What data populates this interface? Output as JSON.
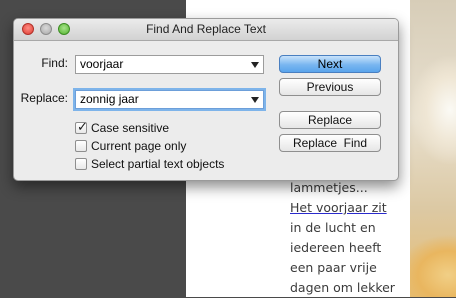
{
  "dialog": {
    "title": "Find And Replace Text",
    "find_label": "Find:",
    "find_value": "voorjaar",
    "replace_label": "Replace:",
    "replace_value": "zonnig jaar",
    "options": [
      {
        "label": "Case sensitive",
        "checked": true
      },
      {
        "label": "Current page only",
        "checked": false
      },
      {
        "label": "Select partial text objects",
        "checked": false
      }
    ],
    "buttons": {
      "next": "Next",
      "previous": "Previous",
      "replace": "Replace",
      "replace_find": "Replace  Find"
    }
  },
  "page_text": {
    "lines": [
      "lammetjes...",
      "Het voorjaar zit",
      "in de lucht en",
      "iedereen heeft",
      "een paar vrije",
      "dagen om lekker"
    ]
  },
  "colors": {
    "default_button": "#79b6f0",
    "focus_ring": "#7eb4ea",
    "text_underline": "#2a2acc"
  }
}
